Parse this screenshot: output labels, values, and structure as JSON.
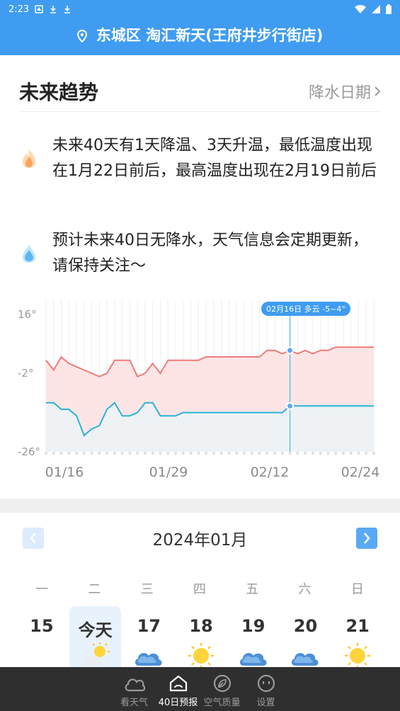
{
  "status": {
    "time": "2:23"
  },
  "header": {
    "location": "东城区 淘汇新天(王府井步行街店)"
  },
  "trend": {
    "title": "未来趋势",
    "link": "降水日期",
    "temp_summary": "未来40天有1天降温、3天升温，最低温度出现在1月22日前后，最高温度出现在2月19日前后",
    "rain_summary": "预计未来40日无降水，天气信息会定期更新，请保持关注～"
  },
  "chart_data": {
    "type": "area",
    "y_tick_labels": [
      "16°",
      "-2°",
      "-26°"
    ],
    "x_tick_labels": [
      "01/16",
      "01/29",
      "02/12",
      "02/24"
    ],
    "high": [
      2,
      -1,
      3,
      1,
      0,
      -1,
      -2,
      -3,
      -2,
      2,
      2,
      2,
      -3,
      -2,
      1,
      -2,
      2,
      2,
      2,
      2,
      2,
      3,
      3,
      3,
      3,
      3,
      3,
      3,
      3,
      5,
      5,
      4,
      5,
      4,
      5,
      4,
      5,
      5,
      6,
      6,
      6,
      6,
      6,
      6
    ],
    "low": [
      -11,
      -11,
      -13,
      -13,
      -15,
      -21,
      -19,
      -18,
      -13,
      -11,
      -15,
      -15,
      -14,
      -11,
      -11,
      -15,
      -15,
      -15,
      -14,
      -14,
      -14,
      -14,
      -14,
      -14,
      -14,
      -14,
      -14,
      -14,
      -14,
      -14,
      -14,
      -14,
      -12,
      -12,
      -12,
      -12,
      -12,
      -12,
      -12,
      -12,
      -12,
      -12,
      -12,
      -12
    ],
    "tooltip": "02月16日 多云 -5~4°",
    "colors": {
      "high": "#f07a7a",
      "low": "#2ab3d8",
      "tooltip": "#3f9cf1"
    }
  },
  "calendar": {
    "month": "2024年01月",
    "weekdays": [
      "一",
      "二",
      "三",
      "四",
      "五",
      "六",
      "日"
    ],
    "days": [
      {
        "num": "15",
        "icon": ""
      },
      {
        "num": "今天",
        "icon": "sun-cloud-icon"
      },
      {
        "num": "17",
        "icon": "cloud-icon"
      },
      {
        "num": "18",
        "icon": "sun-icon"
      },
      {
        "num": "19",
        "icon": "cloud-icon"
      },
      {
        "num": "20",
        "icon": "cloud-icon"
      },
      {
        "num": "21",
        "icon": "sun-icon"
      }
    ]
  },
  "bottom_nav": [
    {
      "label": "看天气",
      "icon": "cloud-outline-icon"
    },
    {
      "label": "40日预报",
      "icon": "home-icon"
    },
    {
      "label": "空气质量",
      "icon": "leaf-icon"
    },
    {
      "label": "设置",
      "icon": "face-icon"
    }
  ],
  "colors": {
    "header": "#3f9cf1",
    "accent": "#5aa9f5",
    "nav_bg": "#2f2f2f"
  }
}
